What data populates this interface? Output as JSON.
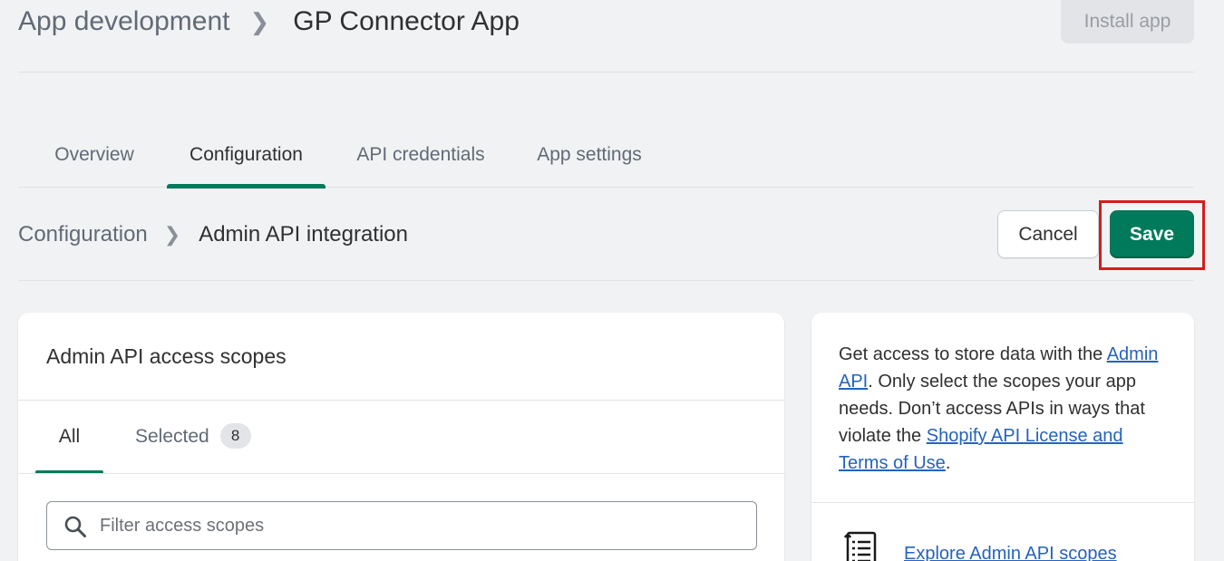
{
  "header": {
    "breadcrumb_parent": "App development",
    "breadcrumb_separator": ">",
    "breadcrumb_current": "GP Connector App",
    "install_button": "Install app"
  },
  "tabs": [
    {
      "label": "Overview",
      "active": false
    },
    {
      "label": "Configuration",
      "active": true
    },
    {
      "label": "API credentials",
      "active": false
    },
    {
      "label": "App settings",
      "active": false
    }
  ],
  "section": {
    "breadcrumb_parent": "Configuration",
    "breadcrumb_separator": ">",
    "breadcrumb_current": "Admin API integration",
    "cancel_label": "Cancel",
    "save_label": "Save"
  },
  "scopes_card": {
    "title": "Admin API access scopes",
    "tab_all": "All",
    "tab_selected": "Selected",
    "selected_count": "8",
    "search_placeholder": "Filter access scopes",
    "search_value": ""
  },
  "info_card": {
    "text_1": "Get access to store data with the ",
    "link_admin_api": "Admin API",
    "text_2": ". Only select the scopes your app needs. Don’t access APIs in ways that violate the ",
    "link_license": "Shopify API License and Terms of Use",
    "text_3": ".",
    "explore_link": "Explore Admin API scopes"
  },
  "colors": {
    "accent_green": "#007a5a",
    "link_blue": "#2463bc",
    "highlight_red": "#d31d1d",
    "background": "#f1f2f4"
  }
}
